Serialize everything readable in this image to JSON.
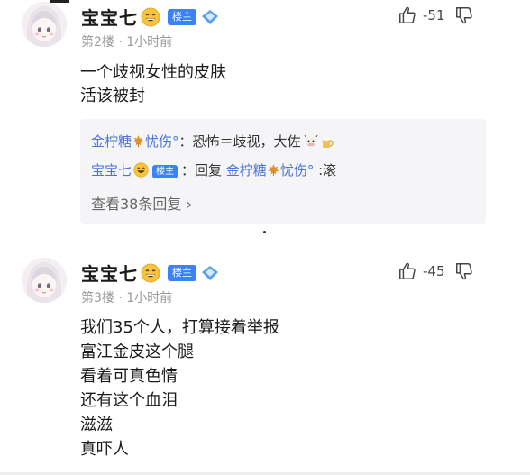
{
  "posts": [
    {
      "username": "宝宝七",
      "badge": "楼主",
      "meta": "第2楼 · 1小时前",
      "likes": "-51",
      "content": [
        "一个歧视女性的皮肤",
        "活该被封"
      ],
      "replies": [
        {
          "name": "金柠糖",
          "suffix": "忧伤°",
          "text": "：恐怖＝歧视，大佐"
        },
        {
          "name": "宝宝七",
          "badge": "楼主",
          "pre": "：回复 ",
          "target_name": "金柠糖",
          "target_suffix": "忧伤°",
          "text": " :滚"
        }
      ],
      "more_replies": "查看38条回复 ›"
    },
    {
      "username": "宝宝七",
      "badge": "楼主",
      "meta": "第3楼 · 1小时前",
      "likes": "-45",
      "content": [
        "我们35个人，打算接着举报",
        "富江金皮这个腿",
        "看着可真色情",
        "还有这个血泪",
        "滋滋",
        "真吓人"
      ]
    }
  ],
  "colors": {
    "badge": "#3b82f6",
    "link": "#4a73d6",
    "reply_bg": "#f5f5f7",
    "meta": "#999999"
  },
  "icons": [
    "avatar",
    "grin-emoji",
    "level-diamond-icon",
    "thumbs-up-icon",
    "thumbs-down-icon",
    "maple-leaf-icon",
    "beer-icon"
  ]
}
